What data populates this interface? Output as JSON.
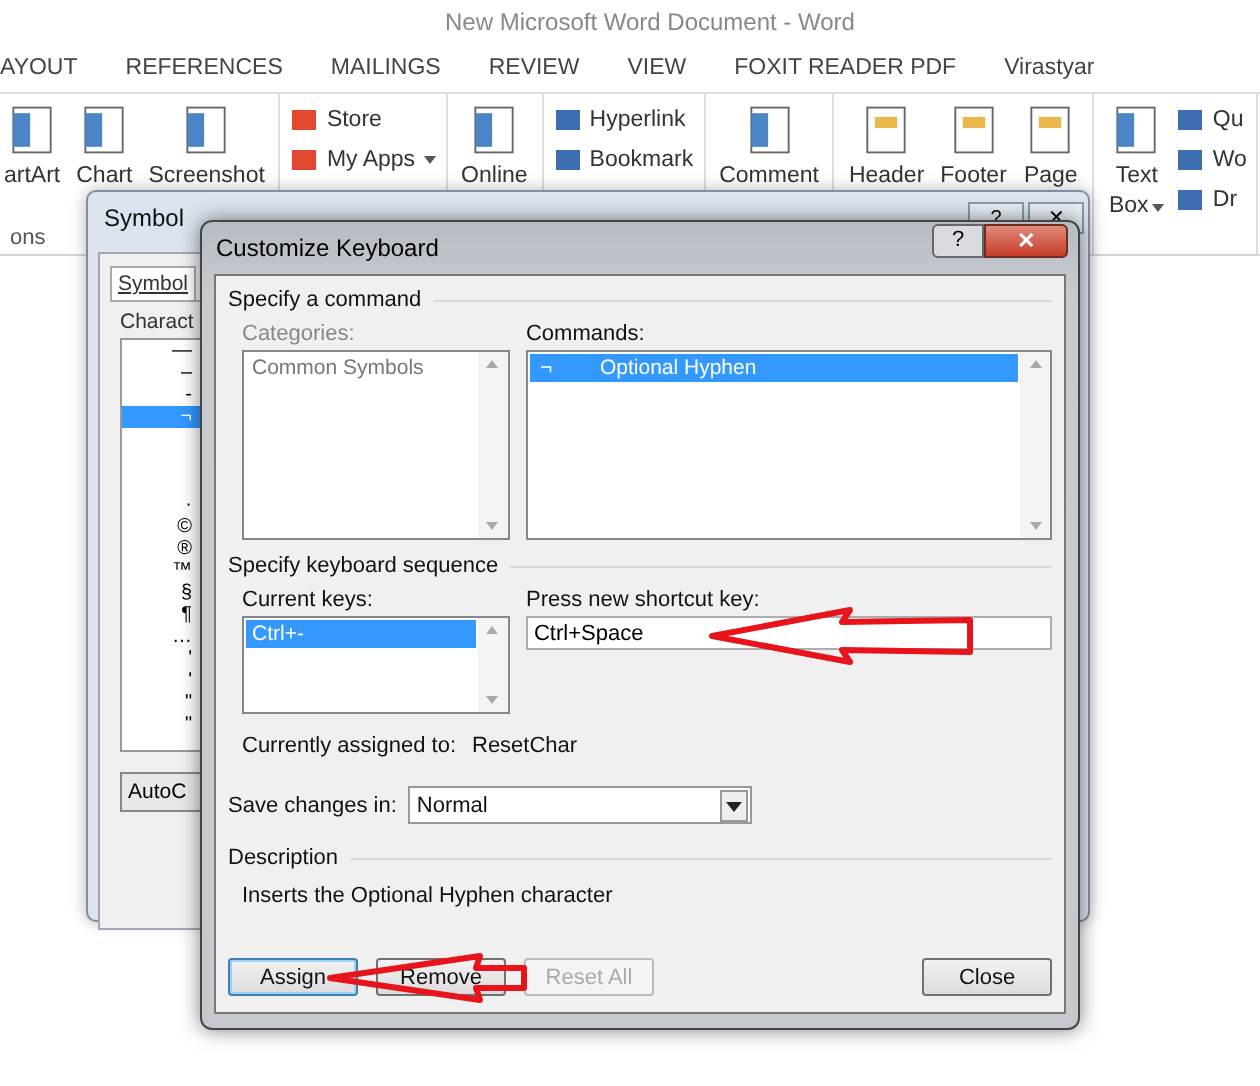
{
  "window": {
    "title": "New Microsoft Word Document - Word"
  },
  "ribbon_tabs": [
    "AYOUT",
    "REFERENCES",
    "MAILINGS",
    "REVIEW",
    "VIEW",
    "FOXIT READER PDF",
    "Virastyar"
  ],
  "ribbon_groups": [
    {
      "caption": "ons",
      "items": [
        {
          "kind": "large",
          "lines": [
            "artArt"
          ],
          "dropdown": false
        },
        {
          "kind": "large",
          "lines": [
            "Chart"
          ],
          "dropdown": false
        },
        {
          "kind": "large",
          "lines": [
            "Screenshot"
          ],
          "dropdown": false
        }
      ]
    },
    {
      "items": [
        {
          "kind": "small",
          "lines": [
            "Store"
          ],
          "dropdown": false
        },
        {
          "kind": "small",
          "lines": [
            "My Apps"
          ],
          "dropdown": true
        }
      ]
    },
    {
      "items": [
        {
          "kind": "large",
          "lines": [
            "Online"
          ],
          "dropdown": false
        }
      ]
    },
    {
      "items": [
        {
          "kind": "small",
          "lines": [
            "Hyperlink"
          ],
          "dropdown": false
        },
        {
          "kind": "small",
          "lines": [
            "Bookmark"
          ],
          "dropdown": false
        }
      ]
    },
    {
      "items": [
        {
          "kind": "large",
          "lines": [
            "Comment"
          ],
          "dropdown": false
        }
      ]
    },
    {
      "items": [
        {
          "kind": "large",
          "lines": [
            "Header"
          ],
          "dropdown": false
        },
        {
          "kind": "large",
          "lines": [
            "Footer"
          ],
          "dropdown": false
        },
        {
          "kind": "large",
          "lines": [
            "Page"
          ],
          "dropdown": false
        }
      ]
    },
    {
      "items": [
        {
          "kind": "large",
          "lines": [
            "Text",
            "Box"
          ],
          "dropdown": true
        },
        {
          "kind": "small",
          "lines": [
            "Qu"
          ],
          "dropdown": false
        },
        {
          "kind": "small",
          "lines": [
            "Wo"
          ],
          "dropdown": false
        },
        {
          "kind": "small",
          "lines": [
            "Dr"
          ],
          "dropdown": false
        }
      ]
    }
  ],
  "symbol_dialog": {
    "title": "Symbol",
    "help": "?",
    "close": "✕",
    "tab": "Symbol",
    "list_label": "Charact",
    "characters": [
      {
        "char": "—",
        "selected": false
      },
      {
        "char": "–",
        "selected": false
      },
      {
        "char": "-",
        "selected": false
      },
      {
        "char": "¬",
        "selected": true
      },
      {
        "selected": false
      },
      {
        "selected": false
      },
      {
        "selected": false
      },
      {
        "char": "·",
        "selected": false
      },
      {
        "char": "©",
        "selected": false
      },
      {
        "char": "®",
        "selected": false
      },
      {
        "char": "™",
        "selected": false
      },
      {
        "char": "§",
        "selected": false
      },
      {
        "char": "¶",
        "selected": false
      },
      {
        "char": "…",
        "selected": false
      },
      {
        "char": "'",
        "selected": false
      },
      {
        "char": "'",
        "selected": false
      },
      {
        "char": "\"",
        "selected": false
      },
      {
        "char": "\"",
        "selected": false
      }
    ],
    "button": "AutoC"
  },
  "customize_keyboard": {
    "title": "Customize Keyboard",
    "help": "?",
    "close": "✕",
    "command_section": "Specify a command",
    "categories": {
      "label": "Categories:",
      "disabled": true,
      "items": [
        {
          "text": "Common Symbols",
          "selected": false
        }
      ]
    },
    "commands": {
      "label": "Commands:",
      "items": [
        {
          "symbol": "¬",
          "text": "Optional Hyphen",
          "selected": true
        }
      ]
    },
    "sequence_section": "Specify keyboard sequence",
    "current_keys": {
      "label": "Current keys:",
      "items": [
        {
          "text": "Ctrl+-",
          "selected": true
        }
      ]
    },
    "new_key": {
      "label": "Press new shortcut key:",
      "value": "Ctrl+Space"
    },
    "assigned": {
      "label": "Currently assigned to:",
      "value": "ResetChar"
    },
    "save_in": {
      "label": "Save changes in:",
      "value": "Normal"
    },
    "description_section": "Description",
    "description": "Inserts the Optional Hyphen character",
    "buttons": [
      {
        "label": "Assign",
        "default": true,
        "disabled": false
      },
      {
        "label": "Remove",
        "default": false,
        "disabled": false
      },
      {
        "label": "Reset All",
        "default": false,
        "disabled": true
      },
      {
        "label": "Close",
        "default": false,
        "disabled": false
      }
    ]
  }
}
